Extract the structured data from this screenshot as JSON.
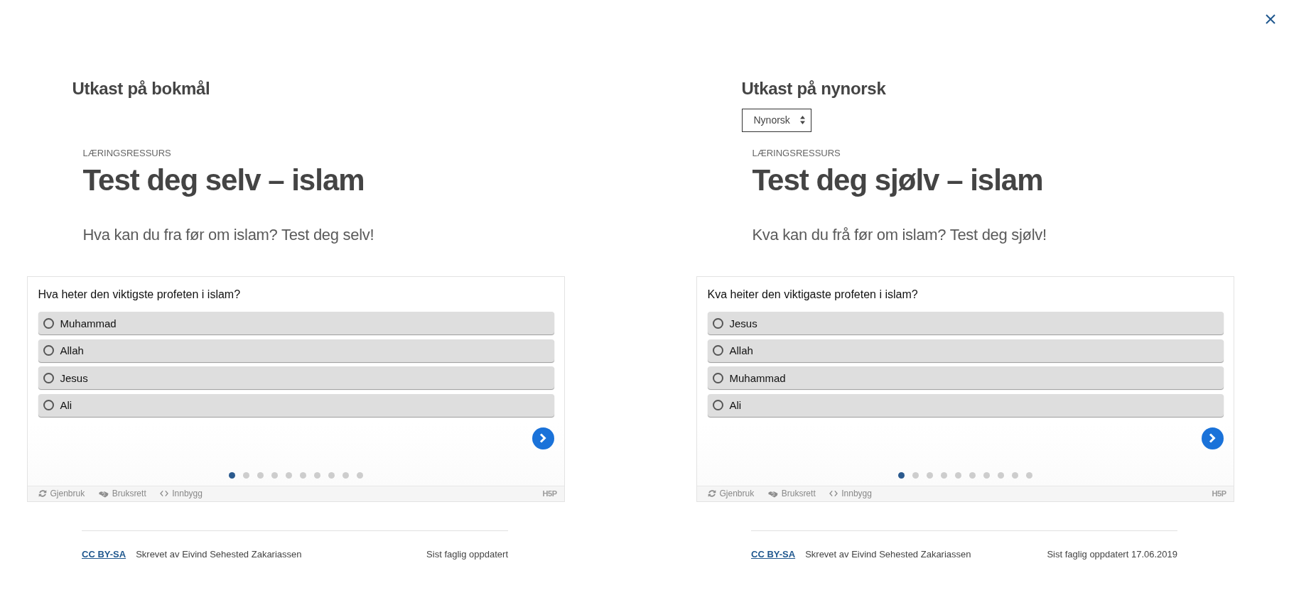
{
  "drafts": [
    {
      "heading": "Utkast på bokmål",
      "article": {
        "label": "LÆRINGSRESSURS",
        "title": "Test deg selv – islam",
        "lead": "Hva kan du fra før om islam? Test deg selv!"
      },
      "quiz": {
        "question": "Hva heter den viktigste profeten i islam?",
        "answers": [
          {
            "text": "Muhammad",
            "selected": false
          },
          {
            "text": "Allah",
            "selected": false
          },
          {
            "text": "Jesus",
            "selected": false
          },
          {
            "text": "Ali",
            "selected": false
          }
        ],
        "pages": [
          {
            "selected": true
          },
          {
            "selected": false
          },
          {
            "selected": false
          },
          {
            "selected": false
          },
          {
            "selected": false
          },
          {
            "selected": false
          },
          {
            "selected": false
          },
          {
            "selected": false
          },
          {
            "selected": false
          },
          {
            "selected": false
          }
        ],
        "actions": [
          "Gjenbruk",
          "Bruksrett",
          "Innbygg"
        ],
        "logo": "H5P"
      },
      "footer": {
        "license": "CC BY-SA",
        "author": "Skrevet av Eivind Sehested Zakariassen",
        "updated": "Sist faglig oppdatert"
      }
    },
    {
      "heading": "Utkast på nynorsk",
      "language_select": {
        "value": "Nynorsk"
      },
      "article": {
        "label": "LÆRINGSRESSURS",
        "title": "Test deg sjølv – islam",
        "lead": "Kva kan du frå før om islam? Test deg sjølv!"
      },
      "quiz": {
        "question": "Kva heiter den viktigaste profeten i islam?",
        "answers": [
          {
            "text": "Jesus",
            "selected": false
          },
          {
            "text": "Allah",
            "selected": false
          },
          {
            "text": "Muhammad",
            "selected": false
          },
          {
            "text": "Ali",
            "selected": false
          }
        ],
        "pages": [
          {
            "selected": true
          },
          {
            "selected": false
          },
          {
            "selected": false
          },
          {
            "selected": false
          },
          {
            "selected": false
          },
          {
            "selected": false
          },
          {
            "selected": false
          },
          {
            "selected": false
          },
          {
            "selected": false
          },
          {
            "selected": false
          }
        ],
        "actions": [
          "Gjenbruk",
          "Bruksrett",
          "Innbygg"
        ],
        "logo": "H5P"
      },
      "footer": {
        "license": "CC BY-SA",
        "author": "Skrevet av Eivind Sehested Zakariassen",
        "updated": "Sist faglig oppdatert 17.06.2019"
      }
    }
  ]
}
